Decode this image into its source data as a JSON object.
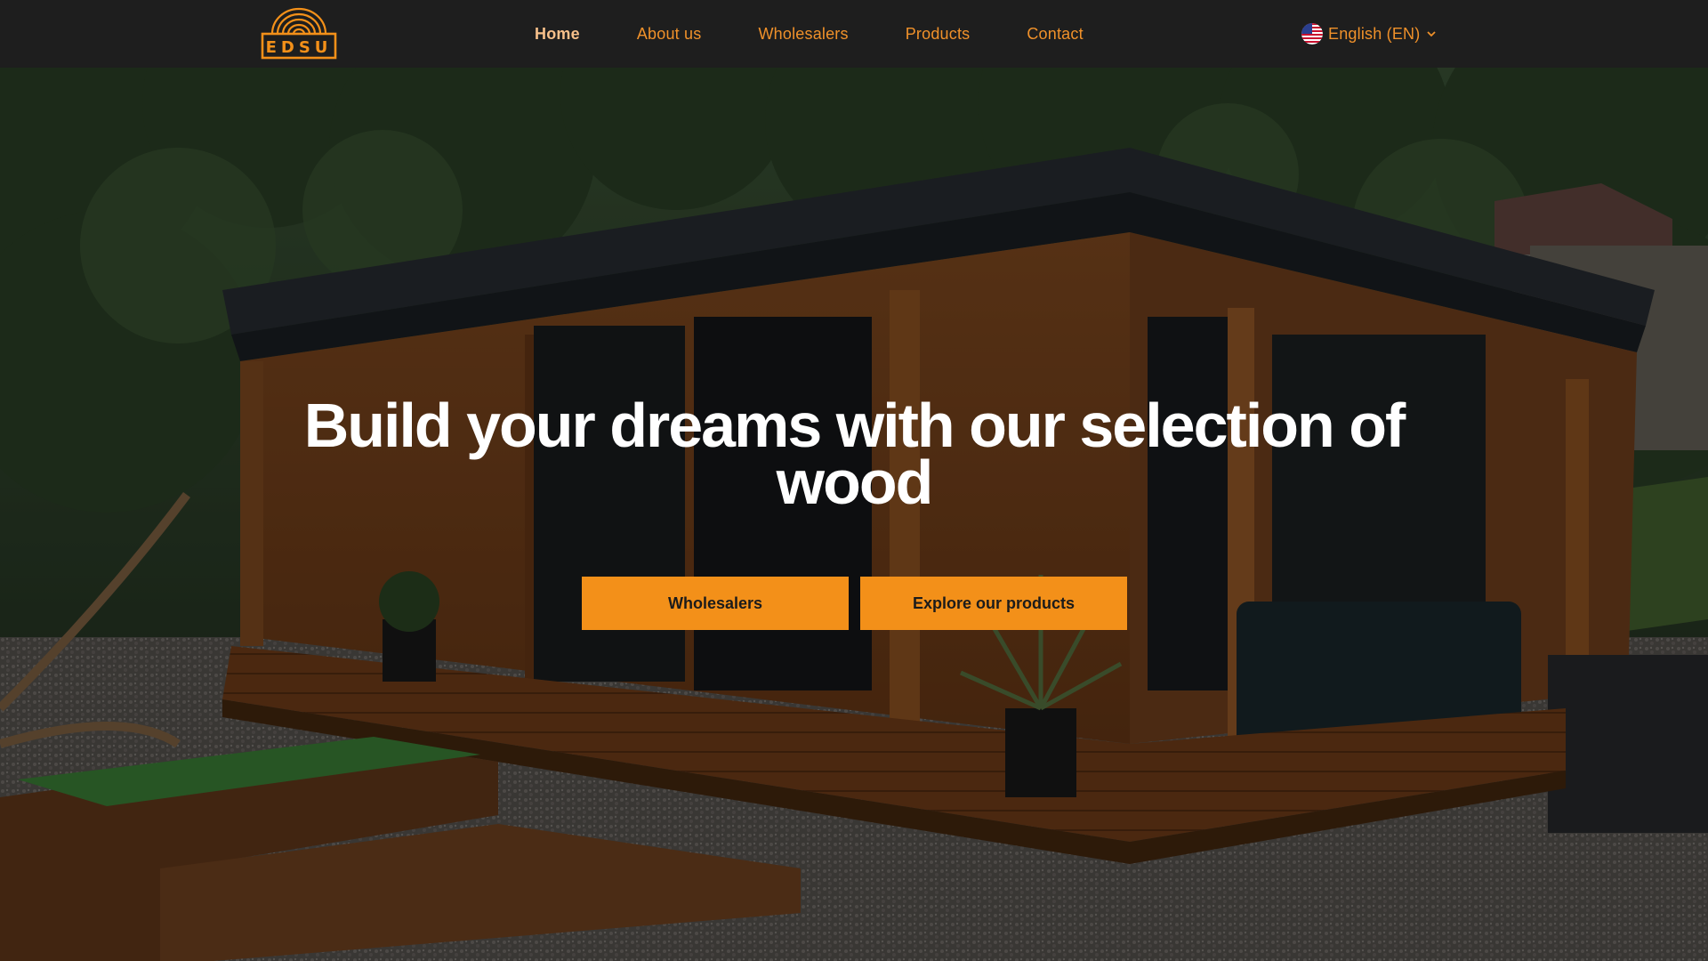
{
  "brand": {
    "logo_text": "EDSU",
    "accent_color": "#f39019"
  },
  "nav": {
    "items": [
      {
        "label": "Home",
        "active": true
      },
      {
        "label": "About us",
        "active": false
      },
      {
        "label": "Wholesalers",
        "active": false
      },
      {
        "label": "Products",
        "active": false
      },
      {
        "label": "Contact",
        "active": false
      }
    ]
  },
  "language": {
    "label": "English (EN)",
    "flag_icon": "us-flag-icon",
    "dropdown_icon": "chevron-down-icon"
  },
  "hero": {
    "title_line1": "Build your dreams with our selection of",
    "title_line2": "wood",
    "buttons": {
      "wholesalers": "Wholesalers",
      "products": "Explore our products"
    }
  }
}
